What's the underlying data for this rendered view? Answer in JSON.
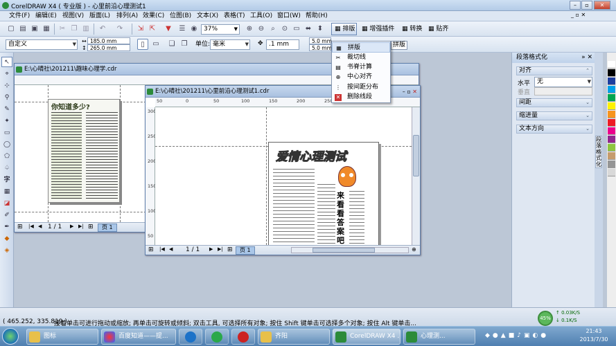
{
  "app": {
    "title": "CorelDRAW X4 ( 专业版 ) - 心里前沿心理测试1"
  },
  "menu": [
    "文件(F)",
    "编辑(E)",
    "视图(V)",
    "版面(L)",
    "排列(A)",
    "效果(C)",
    "位图(B)",
    "文本(X)",
    "表格(T)",
    "工具(O)",
    "窗口(W)",
    "帮助(H)"
  ],
  "toolbar": {
    "zoom": "37%",
    "paiban": "排版",
    "enhance": "增强插件",
    "convert": "转换",
    "paste": "贴齐"
  },
  "propbar": {
    "preset": "自定义",
    "width": "185.0 mm",
    "height": "265.0 mm",
    "unit_label": "单位:",
    "unit": "毫米",
    "nudge": ".1 mm",
    "dup_x": "5.0 mm",
    "dup_y": "5.0 mm"
  },
  "dropdown": {
    "tip": "拼版",
    "items": [
      "拼版",
      "裁切线",
      "书脊计算",
      "中心对齐",
      "按间距分布",
      "删除线段"
    ]
  },
  "doc1": {
    "title": "E:\\心晴社\\201211\\趣味心理学.cdr",
    "heading": "你知道多少?",
    "pages": "1 / 1",
    "page_tab": "页 1"
  },
  "doc2": {
    "title": "E:\\心晴社\\201211\\心里前沿心理测试1.cdr",
    "heading": "爱情心理测试",
    "pages": "1 / 1",
    "page_tab": "页 1",
    "ruler_h": [
      "50",
      "0",
      "50",
      "100",
      "150",
      "200",
      "250",
      "300",
      "350"
    ],
    "ruler_v": [
      "300",
      "250",
      "200",
      "150",
      "100",
      "50"
    ],
    "side_text": "来看看答案吧"
  },
  "docker": {
    "title": "段落格式化",
    "align": "对齐",
    "horizontal_label": "水平",
    "horizontal_value": "无",
    "vertical_label": "垂直",
    "spacing": "间距",
    "indent": "缩进量",
    "direction": "文本方向"
  },
  "side_tab": "段落格式化",
  "status": {
    "coords": "( 465.252, 335.819 )",
    "hint": "接着单击可进行拖动或缩放; 再单击可旋转或倾斜; 双击工具, 可选择所有对象; 按住 Shift 键单击可选择多个对象; 按住 Alt 键单击...",
    "net_pct": "45%",
    "net_up": "0.03K/S",
    "net_down": "0.1K/S"
  },
  "taskbar": {
    "items": [
      "图标",
      "百度知道——提...",
      "齐阳",
      "CorelDRAW X4 ...",
      "心理测..."
    ],
    "time": "21:43",
    "date": "2013/7/30"
  },
  "palette": [
    "#ffffff",
    "#000000",
    "#1f3f9f",
    "#00a0e9",
    "#00a651",
    "#fff200",
    "#f7941d",
    "#ed1c24",
    "#ec008c",
    "#92278f",
    "#8dc63f",
    "#c69c6d",
    "#959595",
    "#d9d9d9"
  ]
}
